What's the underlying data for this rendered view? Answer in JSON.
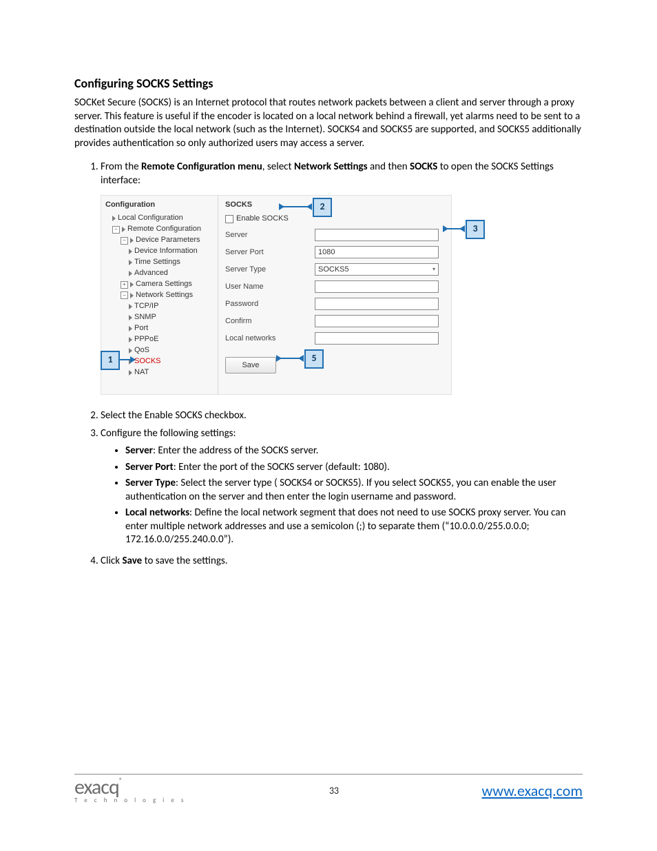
{
  "section_title": "Configuring SOCKS Settings",
  "intro": "SOCKet Secure (SOCKS) is an Internet protocol that routes network packets between a client and server through a proxy server. This feature is useful if the encoder is located on a local network behind a firewall, yet alarms need to be sent to a destination outside the local network (such as the Internet). SOCKS4 and SOCKS5 are supported, and SOCKS5 additionally provides authentication so only authorized users may access a server.",
  "step1_pre": "From the ",
  "step1_bold1": "Remote Configuration menu",
  "step1_mid1": ", select ",
  "step1_bold2": "Network Settings",
  "step1_mid2": " and then ",
  "step1_bold3": "SOCKS",
  "step1_post": " to open the SOCKS Settings interface:",
  "step2": "Select the Enable SOCKS checkbox.",
  "step3": "Configure the following settings:",
  "bullets": {
    "server_b": "Server",
    "server_t": ": Enter the address of the SOCKS server.",
    "port_b": "Server Port",
    "port_t": ": Enter the port of the SOCKS server (default: 1080).",
    "type_b": "Server Type",
    "type_t": ": Select the server type ( SOCKS4 or SOCKS5). If you select SOCKS5, you can enable the user authentication on the server and then enter the login username and password.",
    "local_b": "Local networks",
    "local_t": ": Define the local network segment that does not need to use SOCKS proxy server. You can enter multiple network addresses and use a semicolon (;) to separate them (“10.0.0.0/255.0.0.0; 172.16.0.0/255.240.0.0”)."
  },
  "step4_pre": "Click ",
  "step4_bold": "Save",
  "step4_post": " to save the settings.",
  "shot": {
    "nav_title": "Configuration",
    "tree": {
      "local": "Local Configuration",
      "remote": "Remote Configuration",
      "device_params": "Device Parameters",
      "device_info": "Device Information",
      "time": "Time Settings",
      "advanced": "Advanced",
      "camera": "Camera Settings",
      "network": "Network Settings",
      "tcpip": "TCP/IP",
      "snmp": "SNMP",
      "port": "Port",
      "pppoe": "PPPoE",
      "qos": "QoS",
      "socks": "SOCKS",
      "nat": "NAT"
    },
    "form": {
      "title": "SOCKS",
      "enable": "Enable SOCKS",
      "server": "Server",
      "server_port": "Server Port",
      "server_port_val": "1080",
      "server_type": "Server Type",
      "server_type_val": "SOCKS5",
      "user": "User Name",
      "password": "Password",
      "confirm": "Confirm",
      "localnets": "Local networks",
      "save": "Save"
    },
    "callouts": {
      "c1": "1",
      "c2": "2",
      "c3": "3",
      "c5": "5"
    }
  },
  "footer": {
    "logo": "exacq",
    "logo_sub": "T e c h n o l o g i e s",
    "page": "33",
    "url": "www.exacq.com"
  }
}
